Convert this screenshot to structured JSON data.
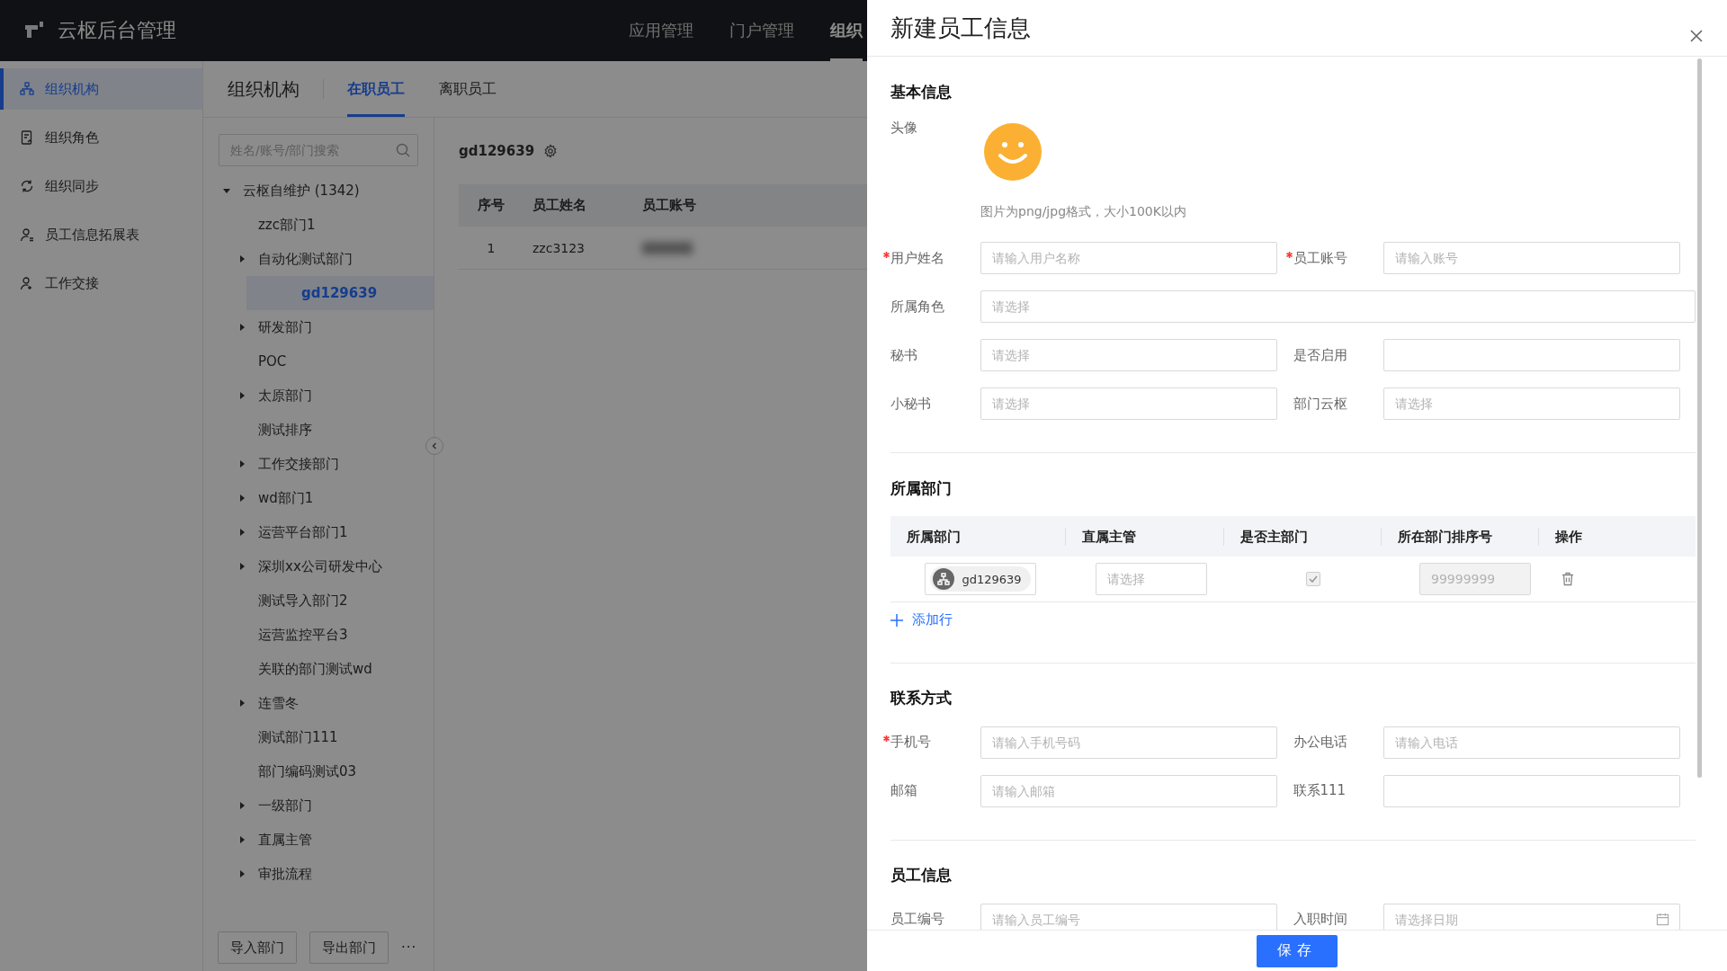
{
  "topbar": {
    "title": "云枢后台管理",
    "nav": [
      {
        "label": "应用管理",
        "selected": false
      },
      {
        "label": "门户管理",
        "selected": false
      },
      {
        "label": "组织",
        "selected": true
      }
    ]
  },
  "sidebar": {
    "items": [
      {
        "label": "组织机构",
        "kind": "org",
        "selected": true
      },
      {
        "label": "组织角色",
        "kind": "role",
        "selected": false
      },
      {
        "label": "组织同步",
        "kind": "sync",
        "selected": false
      },
      {
        "label": "员工信息拓展表",
        "kind": "user",
        "selected": false
      },
      {
        "label": "工作交接",
        "kind": "handover",
        "selected": false
      }
    ]
  },
  "main": {
    "title": "组织机构",
    "tabs": [
      {
        "label": "在职员工",
        "selected": true
      },
      {
        "label": "离职员工",
        "selected": false
      }
    ]
  },
  "tree": {
    "search": {
      "placeholder": "姓名/账号/部门搜索"
    },
    "nodes": [
      {
        "label": "云枢自维护 (1342)",
        "expandable": true,
        "expanded": true,
        "selected": false,
        "children": [
          {
            "label": "zzc部门1",
            "expandable": false,
            "expanded": false,
            "selected": false
          },
          {
            "label": "自动化测试部门",
            "expandable": true,
            "expanded": false,
            "selected": false
          },
          {
            "label": "gd129639",
            "expandable": false,
            "expanded": false,
            "selected": true
          },
          {
            "label": "研发部门",
            "expandable": true,
            "expanded": false,
            "selected": false
          },
          {
            "label": "POC",
            "expandable": false,
            "expanded": false,
            "selected": false
          },
          {
            "label": "太原部门",
            "expandable": true,
            "expanded": false,
            "selected": false
          },
          {
            "label": "测试排序",
            "expandable": false,
            "expanded": false,
            "selected": false
          },
          {
            "label": "工作交接部门",
            "expandable": true,
            "expanded": false,
            "selected": false
          },
          {
            "label": "wd部门1",
            "expandable": true,
            "expanded": false,
            "selected": false
          },
          {
            "label": "运营平台部门1",
            "expandable": true,
            "expanded": false,
            "selected": false
          },
          {
            "label": "深圳xx公司研发中心",
            "expandable": true,
            "expanded": false,
            "selected": false
          },
          {
            "label": "测试导入部门2",
            "expandable": false,
            "expanded": false,
            "selected": false
          },
          {
            "label": "运营监控平台3",
            "expandable": false,
            "expanded": false,
            "selected": false
          },
          {
            "label": "关联的部门测试wd",
            "expandable": false,
            "expanded": false,
            "selected": false
          },
          {
            "label": "连雪冬",
            "expandable": true,
            "expanded": false,
            "selected": false
          },
          {
            "label": "测试部门111",
            "expandable": false,
            "expanded": false,
            "selected": false
          },
          {
            "label": "部门编码测试03",
            "expandable": false,
            "expanded": false,
            "selected": false
          },
          {
            "label": "一级部门",
            "expandable": true,
            "expanded": false,
            "selected": false
          },
          {
            "label": "直属主管",
            "expandable": true,
            "expanded": false,
            "selected": false
          },
          {
            "label": "审批流程",
            "expandable": true,
            "expanded": false,
            "selected": false
          }
        ]
      }
    ],
    "buttons": [
      "导入部门",
      "导出部门"
    ],
    "more": "···"
  },
  "content": {
    "department": "gd129639",
    "table": {
      "columns": [
        "序号",
        "员工姓名",
        "员工账号"
      ],
      "rows": [
        {
          "cells": [
            "1",
            "zzc3123"
          ]
        }
      ]
    }
  },
  "drawer": {
    "title": "新建员工信息",
    "sections": [
      {
        "kind": "form",
        "title": "基本信息",
        "avatar": {
          "label": "头像",
          "hint": "图片为png/jpg格式，大小100K以内"
        },
        "rows": [
          [
            {
              "label": "用户姓名",
              "required": true,
              "kind": "input",
              "placeholder": "请输入用户名称"
            },
            {
              "label": "员工账号",
              "required": true,
              "kind": "input",
              "placeholder": "请输入账号"
            }
          ],
          [
            {
              "label": "所属角色",
              "required": false,
              "kind": "input",
              "placeholder": "请选择"
            }
          ],
          [
            {
              "label": "秘书",
              "required": false,
              "kind": "input",
              "placeholder": "请选择"
            },
            {
              "label": "是否启用",
              "required": false,
              "kind": "input"
            }
          ],
          [
            {
              "label": "小秘书",
              "required": false,
              "kind": "input",
              "placeholder": "请选择"
            },
            {
              "label": "部门云枢",
              "required": false,
              "kind": "input",
              "placeholder": "请选择"
            }
          ]
        ]
      },
      {
        "kind": "table",
        "title": "所属部门",
        "columns": [
          "所属部门",
          "直属主管",
          "是否主部门",
          "所在部门排序号",
          "操作"
        ],
        "rows": [
          {
            "department": "gd129639",
            "manager_placeholder": "请选择",
            "primary": true,
            "disabled": true,
            "order_placeholder": "99999999"
          }
        ],
        "add_label": "添加行"
      },
      {
        "kind": "form",
        "title": "联系方式",
        "rows": [
          [
            {
              "label": "手机号",
              "required": true,
              "kind": "input",
              "placeholder": "请输入手机号码"
            },
            {
              "label": "办公电话",
              "required": false,
              "kind": "input",
              "placeholder": "请输入电话"
            }
          ],
          [
            {
              "label": "邮箱",
              "required": false,
              "kind": "input",
              "placeholder": "请输入邮箱"
            },
            {
              "label": "联系111",
              "required": false,
              "kind": "input"
            }
          ]
        ]
      },
      {
        "kind": "form",
        "title": "员工信息",
        "rows": [
          [
            {
              "label": "员工编号",
              "required": false,
              "kind": "input",
              "placeholder": "请输入员工编号"
            },
            {
              "label": "入职时间",
              "required": false,
              "kind": "date",
              "placeholder": "请选择日期"
            }
          ]
        ]
      }
    ],
    "save": "保存"
  }
}
